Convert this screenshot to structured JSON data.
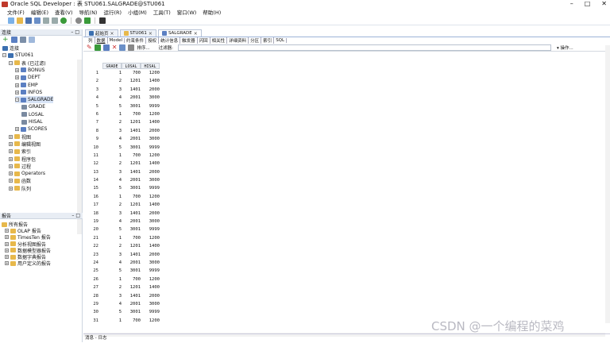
{
  "window": {
    "title": "Oracle SQL Developer : 表 STU061.SALGRADE@STU061",
    "min": "–",
    "max": "□",
    "close": "✕"
  },
  "menu": [
    "文件(F)",
    "编辑(E)",
    "查看(V)",
    "导航(N)",
    "运行(R)",
    "小组(M)",
    "工具(T)",
    "窗口(W)",
    "帮助(H)"
  ],
  "left": {
    "connections_title": "连接",
    "tree": [
      {
        "label": "连接",
        "level": 0,
        "icon": "db"
      },
      {
        "label": "STU061",
        "level": 0,
        "icon": "db",
        "exp": "−"
      },
      {
        "label": "表 (已过滤)",
        "level": 1,
        "icon": "fold",
        "exp": "−"
      },
      {
        "label": "BONUS",
        "level": 2,
        "icon": "tbl",
        "exp": "+"
      },
      {
        "label": "DEPT",
        "level": 2,
        "icon": "tbl",
        "exp": "+"
      },
      {
        "label": "EMP",
        "level": 2,
        "icon": "tbl",
        "exp": "+"
      },
      {
        "label": "INFOS",
        "level": 2,
        "icon": "tbl",
        "exp": "+"
      },
      {
        "label": "SALGRADE",
        "level": 2,
        "icon": "tbl",
        "exp": "−",
        "sel": true
      },
      {
        "label": "GRADE",
        "level": 3,
        "icon": "col"
      },
      {
        "label": "LOSAL",
        "level": 3,
        "icon": "col"
      },
      {
        "label": "HISAL",
        "level": 3,
        "icon": "col"
      },
      {
        "label": "SCORES",
        "level": 2,
        "icon": "tbl",
        "exp": "+"
      },
      {
        "label": "视图",
        "level": 1,
        "icon": "fold",
        "exp": "+"
      },
      {
        "label": "编辑视图",
        "level": 1,
        "icon": "fold",
        "exp": "+"
      },
      {
        "label": "索引",
        "level": 1,
        "icon": "fold",
        "exp": "+"
      },
      {
        "label": "程序包",
        "level": 1,
        "icon": "fold",
        "exp": "+"
      },
      {
        "label": "过程",
        "level": 1,
        "icon": "fold",
        "exp": "+"
      },
      {
        "label": "Operators",
        "level": 1,
        "icon": "fold",
        "exp": "+"
      },
      {
        "label": "函数",
        "level": 1,
        "icon": "fold",
        "exp": "+"
      },
      {
        "label": "队列",
        "level": 1,
        "icon": "fold",
        "exp": "+"
      }
    ],
    "reports_title": "报告",
    "reports": [
      {
        "label": "所有报告",
        "level": 0
      },
      {
        "label": "OLAP 报告",
        "level": 1
      },
      {
        "label": "TimesTen 报告",
        "level": 1
      },
      {
        "label": "分析视图报告",
        "level": 1
      },
      {
        "label": "数据模型器报告",
        "level": 1
      },
      {
        "label": "数据字典报告",
        "level": 1
      },
      {
        "label": "用户定义的报告",
        "level": 1
      }
    ]
  },
  "main": {
    "tabs": [
      {
        "label": "起始页"
      },
      {
        "label": "STU061"
      },
      {
        "label": "SALGRADE",
        "active": true
      }
    ],
    "subtabs": [
      "列",
      "数据",
      "Model",
      "约束条件",
      "授权",
      "统计信息",
      "触发器",
      "闪回",
      "相关性",
      "详细资料",
      "分区",
      "索引",
      "SQL"
    ],
    "gridtools": {
      "sort": "排序...",
      "filter": "过滤器:",
      "actions": "▾ 操作..."
    },
    "columns": [
      "GRADE",
      "LOSAL",
      "HISAL"
    ],
    "rows": [
      [
        1,
        700,
        1200
      ],
      [
        2,
        1201,
        1400
      ],
      [
        3,
        1401,
        2000
      ],
      [
        4,
        2001,
        3000
      ],
      [
        5,
        3001,
        9999
      ],
      [
        1,
        700,
        1200
      ],
      [
        2,
        1201,
        1400
      ],
      [
        3,
        1401,
        2000
      ],
      [
        4,
        2001,
        3000
      ],
      [
        5,
        3001,
        9999
      ],
      [
        1,
        700,
        1200
      ],
      [
        2,
        1201,
        1400
      ],
      [
        3,
        1401,
        2000
      ],
      [
        4,
        2001,
        3000
      ],
      [
        5,
        3001,
        9999
      ],
      [
        1,
        700,
        1200
      ],
      [
        2,
        1201,
        1400
      ],
      [
        3,
        1401,
        2000
      ],
      [
        4,
        2001,
        3000
      ],
      [
        5,
        3001,
        9999
      ],
      [
        1,
        700,
        1200
      ],
      [
        2,
        1201,
        1400
      ],
      [
        3,
        1401,
        2000
      ],
      [
        4,
        2001,
        3000
      ],
      [
        5,
        3001,
        9999
      ],
      [
        1,
        700,
        1200
      ],
      [
        2,
        1201,
        1400
      ],
      [
        3,
        1401,
        2000
      ],
      [
        4,
        2001,
        3000
      ],
      [
        5,
        3001,
        9999
      ],
      [
        1,
        700,
        1200
      ]
    ]
  },
  "status": "消息 - 日志",
  "watermark": "CSDN @一个编程的菜鸡"
}
